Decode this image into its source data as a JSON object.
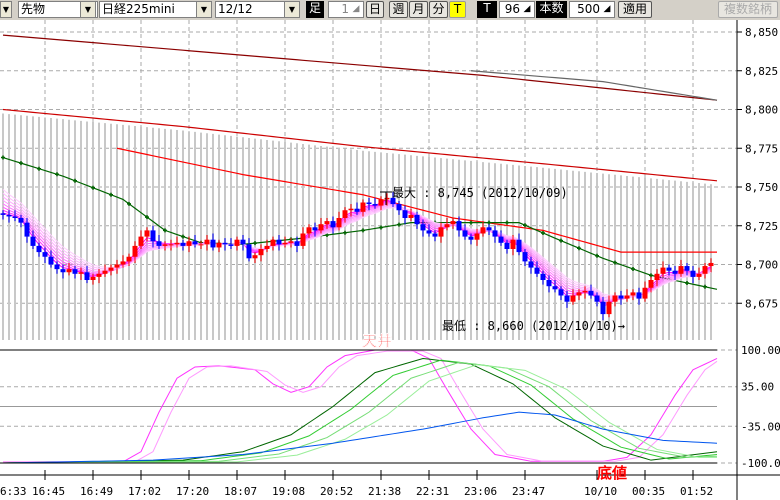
{
  "toolbar": {
    "left_arrow": "▼",
    "market": "先物",
    "instrument": "日経225mini",
    "contract": "12/12",
    "bar_label": "足",
    "bar_value": "1",
    "daily": "日",
    "weekly": "週",
    "monthly": "月",
    "minute": "分",
    "tick": "T",
    "t_label": "T",
    "t_value": "96",
    "count_label": "本数",
    "count_value": "500",
    "apply": "適用",
    "multi_symbol": "複数銘柄",
    "dropdown_arrow": "▼",
    "spin_icon": "◢"
  },
  "annotations": {
    "max_label": "最大 : 8,745 (2012/10/09)",
    "min_label": "最低 : 8,660 (2012/10/10)→",
    "top_label": "天井",
    "bottom_label": "底値"
  },
  "colors": {
    "up": "#ff0000",
    "down": "#0000ff",
    "ribbon": "#ff66ff",
    "ma_green": "#006400",
    "ma_red": "#ff0000",
    "ma_darkred": "#8b0000",
    "osc_blue": "#0055ee",
    "annotation_red": "#ff0000"
  },
  "chart_data": [
    {
      "type": "candlestick",
      "y_ticks": [
        "8,850",
        "8,825",
        "8,800",
        "8,775",
        "8,750",
        "8,725",
        "8,700",
        "8,675"
      ],
      "y_tick_values": [
        8850,
        8825,
        8800,
        8775,
        8750,
        8725,
        8700,
        8675
      ],
      "ylim": [
        8670,
        8855
      ],
      "x_ticks": [
        "6:33",
        "16:45",
        "16:49",
        "17:02",
        "17:20",
        "18:07",
        "19:08",
        "20:52",
        "21:38",
        "22:31",
        "23:06",
        "23:47",
        "10/10",
        "00:35",
        "01:52"
      ],
      "x_tick_index": [
        -1,
        7,
        15,
        23,
        31,
        39,
        47,
        55,
        63,
        71,
        79,
        87,
        99,
        107,
        115
      ],
      "closes": [
        8732,
        8731,
        8730,
        8727,
        8718,
        8712,
        8708,
        8705,
        8700,
        8697,
        8695,
        8697,
        8694,
        8695,
        8690,
        8692,
        8694,
        8696,
        8698,
        8700,
        8702,
        8705,
        8712,
        8718,
        8722,
        8715,
        8712,
        8713,
        8713,
        8714,
        8712,
        8715,
        8713,
        8713,
        8716,
        8711,
        8714,
        8713,
        8712,
        8716,
        8713,
        8704,
        8706,
        8710,
        8712,
        8716,
        8713,
        8714,
        8715,
        8712,
        8720,
        8724,
        8722,
        8726,
        8728,
        8724,
        8730,
        8735,
        8736,
        8734,
        8740,
        8739,
        8738,
        8742,
        8743,
        8739,
        8735,
        8730,
        8732,
        8726,
        8722,
        8720,
        8718,
        8724,
        8726,
        8728,
        8722,
        8718,
        8716,
        8720,
        8724,
        8722,
        8718,
        8714,
        8710,
        8716,
        8708,
        8702,
        8698,
        8694,
        8690,
        8686,
        8684,
        8680,
        8676,
        8680,
        8682,
        8683,
        8680,
        8676,
        8668,
        8676,
        8680,
        8678,
        8680,
        8682,
        8678,
        8685,
        8690,
        8694,
        8698,
        8696,
        8694,
        8699,
        8696,
        8692,
        8694,
        8699,
        8701
      ],
      "lines": [
        {
          "color": "#8b0000",
          "points": [
            [
              0,
              8848
            ],
            [
              40,
              8835
            ],
            [
              80,
              8822
            ],
            [
              119,
              8806
            ]
          ]
        },
        {
          "color": "#666666",
          "points": [
            [
              78,
              8825
            ],
            [
              100,
              8818
            ],
            [
              119,
              8806
            ]
          ]
        },
        {
          "color": "#cc0000",
          "points": [
            [
              0,
              8800
            ],
            [
              30,
              8789
            ],
            [
              60,
              8776
            ],
            [
              90,
              8765
            ],
            [
              119,
              8754
            ]
          ]
        },
        {
          "color": "#ff0000",
          "points": [
            [
              19,
              8775
            ],
            [
              40,
              8758
            ],
            [
              60,
              8745
            ],
            [
              75,
              8730
            ],
            [
              90,
              8722
            ],
            [
              103,
              8708
            ],
            [
              119,
              8708
            ]
          ]
        },
        {
          "color": "#006400",
          "markers": true,
          "points": [
            [
              0,
              8769
            ],
            [
              10,
              8757
            ],
            [
              20,
              8742
            ],
            [
              27,
              8722
            ],
            [
              33,
              8714
            ],
            [
              40,
              8713
            ],
            [
              50,
              8717
            ],
            [
              60,
              8722
            ],
            [
              68,
              8727
            ],
            [
              80,
              8727
            ],
            [
              86,
              8727
            ],
            [
              92,
              8717
            ],
            [
              100,
              8704
            ],
            [
              108,
              8693
            ],
            [
              119,
              8684
            ]
          ]
        }
      ],
      "ribbon_periods": [
        3,
        4,
        5,
        6,
        7,
        8,
        9,
        10
      ]
    },
    {
      "type": "line",
      "y_ticks": [
        "100.00",
        "35.00",
        "-35.00",
        "-100.0"
      ],
      "y_tick_values": [
        100,
        35,
        -35,
        -100
      ],
      "ylim": [
        -100,
        100
      ],
      "series": [
        {
          "color": "#ff33ff",
          "points": [
            [
              0,
              -98
            ],
            [
              20,
              -98
            ],
            [
              23,
              -80
            ],
            [
              26,
              -10
            ],
            [
              29,
              50
            ],
            [
              32,
              70
            ],
            [
              36,
              72
            ],
            [
              42,
              65
            ],
            [
              45,
              40
            ],
            [
              48,
              25
            ],
            [
              51,
              35
            ],
            [
              54,
              70
            ],
            [
              57,
              90
            ],
            [
              62,
              100
            ],
            [
              68,
              100
            ],
            [
              71,
              85
            ],
            [
              74,
              30
            ],
            [
              78,
              -40
            ],
            [
              82,
              -85
            ],
            [
              88,
              -97
            ],
            [
              100,
              -97
            ],
            [
              104,
              -90
            ],
            [
              108,
              -50
            ],
            [
              112,
              20
            ],
            [
              115,
              65
            ],
            [
              119,
              85
            ]
          ]
        },
        {
          "color": "#ff99ff",
          "points": [
            [
              0,
              -98
            ],
            [
              22,
              -98
            ],
            [
              25,
              -80
            ],
            [
              28,
              -10
            ],
            [
              31,
              50
            ],
            [
              34,
              70
            ],
            [
              38,
              72
            ],
            [
              44,
              62
            ],
            [
              47,
              38
            ],
            [
              50,
              25
            ],
            [
              53,
              35
            ],
            [
              56,
              70
            ],
            [
              59,
              90
            ],
            [
              64,
              98
            ],
            [
              70,
              98
            ],
            [
              73,
              85
            ],
            [
              76,
              30
            ],
            [
              80,
              -40
            ],
            [
              84,
              -85
            ],
            [
              90,
              -97
            ],
            [
              102,
              -97
            ],
            [
              106,
              -90
            ],
            [
              110,
              -50
            ],
            [
              114,
              20
            ],
            [
              117,
              65
            ],
            [
              119,
              80
            ]
          ]
        },
        {
          "color": "#006600",
          "points": [
            [
              0,
              -100
            ],
            [
              30,
              -95
            ],
            [
              40,
              -80
            ],
            [
              48,
              -50
            ],
            [
              55,
              0
            ],
            [
              62,
              60
            ],
            [
              70,
              85
            ],
            [
              78,
              75
            ],
            [
              85,
              40
            ],
            [
              92,
              -20
            ],
            [
              100,
              -70
            ],
            [
              108,
              -95
            ],
            [
              119,
              -80
            ]
          ]
        },
        {
          "color": "#33cc33",
          "points": [
            [
              0,
              -100
            ],
            [
              33,
              -96
            ],
            [
              43,
              -82
            ],
            [
              51,
              -52
            ],
            [
              58,
              -5
            ],
            [
              65,
              55
            ],
            [
              73,
              82
            ],
            [
              81,
              72
            ],
            [
              88,
              38
            ],
            [
              95,
              -22
            ],
            [
              103,
              -72
            ],
            [
              111,
              -93
            ],
            [
              119,
              -85
            ]
          ]
        },
        {
          "color": "#77dd77",
          "points": [
            [
              0,
              -100
            ],
            [
              36,
              -97
            ],
            [
              46,
              -84
            ],
            [
              54,
              -55
            ],
            [
              61,
              -10
            ],
            [
              68,
              50
            ],
            [
              76,
              78
            ],
            [
              84,
              68
            ],
            [
              91,
              35
            ],
            [
              98,
              -25
            ],
            [
              106,
              -74
            ],
            [
              114,
              -90
            ],
            [
              119,
              -88
            ]
          ]
        },
        {
          "color": "#99ee99",
          "points": [
            [
              0,
              -100
            ],
            [
              39,
              -98
            ],
            [
              49,
              -86
            ],
            [
              57,
              -58
            ],
            [
              64,
              -15
            ],
            [
              71,
              45
            ],
            [
              79,
              74
            ],
            [
              87,
              64
            ],
            [
              94,
              30
            ],
            [
              101,
              -28
            ],
            [
              109,
              -76
            ],
            [
              116,
              -90
            ],
            [
              119,
              -90
            ]
          ]
        },
        {
          "color": "#0055ee",
          "points": [
            [
              0,
              -100
            ],
            [
              25,
              -95
            ],
            [
              40,
              -85
            ],
            [
              55,
              -65
            ],
            [
              70,
              -40
            ],
            [
              80,
              -20
            ],
            [
              86,
              -10
            ],
            [
              92,
              -15
            ],
            [
              100,
              -40
            ],
            [
              110,
              -60
            ],
            [
              119,
              -65
            ]
          ]
        }
      ]
    }
  ]
}
